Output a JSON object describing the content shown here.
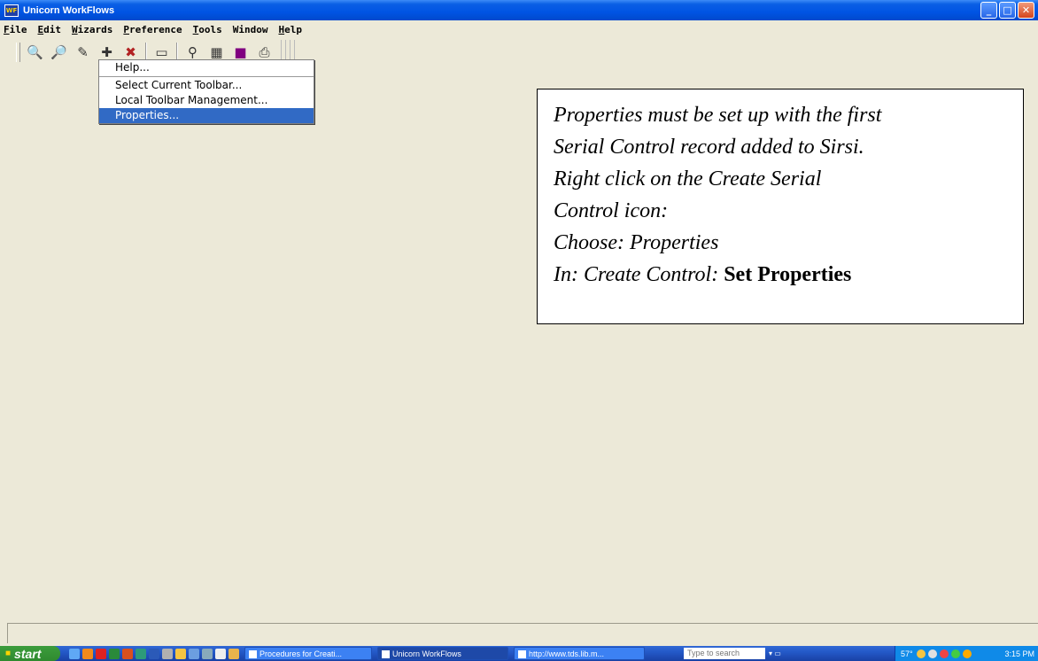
{
  "window": {
    "title": "Unicorn WorkFlows",
    "icon_label": "WF",
    "controls": [
      "_",
      "□",
      "✕"
    ]
  },
  "menubar": [
    {
      "label": "File",
      "accel": "F",
      "rest": "ile"
    },
    {
      "label": "Edit",
      "accel": "E",
      "rest": "dit"
    },
    {
      "label": "Wizards",
      "accel": "W",
      "rest": "izards"
    },
    {
      "label": "Preference",
      "accel": "P",
      "rest": "reference"
    },
    {
      "label": "Tools",
      "accel": "T",
      "rest": "ools"
    },
    {
      "label": "Window",
      "accel": "",
      "rest": "Window"
    },
    {
      "label": "Help",
      "accel": "H",
      "rest": "elp"
    }
  ],
  "toolbar": {
    "icons": [
      "search-items-icon",
      "display-item-icon",
      "modify-item-icon",
      "create-serial-control-icon",
      "remove-item-icon",
      "user-card-icon",
      "helper-icon",
      "report-icon",
      "help-book-icon",
      "print-icon"
    ]
  },
  "context_menu": {
    "items": [
      "Help...",
      "Select Current Toolbar...",
      "Local Toolbar Management...",
      "Properties..."
    ],
    "active_index": 3
  },
  "note": {
    "lines": [
      "Properties must be set up with the first",
      "Serial Control record added to Sirsi.",
      "Right click on the Create Serial",
      "Control icon:",
      "Choose: Properties"
    ],
    "last_line_italic": "In: Create Control:",
    "last_line_bold": "Set Properties"
  },
  "taskbar": {
    "start_label": "start",
    "tasks": [
      "Procedures for Creati...",
      "Unicorn WorkFlows",
      "http://www.tds.lib.m..."
    ],
    "active_task_index": 1,
    "search_placeholder": "Type to search",
    "temperature": "57°",
    "clock": "3:15 PM"
  }
}
